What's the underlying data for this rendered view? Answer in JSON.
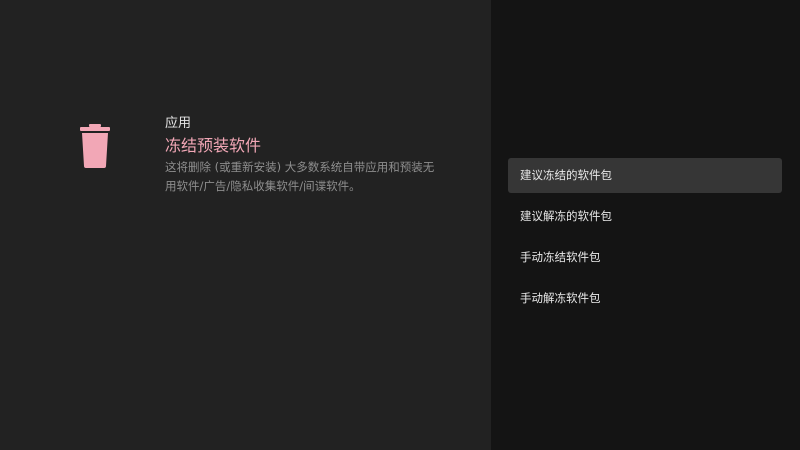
{
  "colors": {
    "accent": "#f2a7b6",
    "left_background": "#222222",
    "right_background": "#141414",
    "selected_item": "#363636"
  },
  "icon": "trash-icon",
  "info": {
    "category": "应用",
    "title": "冻结预装软件",
    "description": "这将删除 (或重新安装) 大多数系统自带应用和预装无用软件/广告/隐私收集软件/间谍软件。"
  },
  "menu": {
    "selected_index": 0,
    "items": [
      {
        "label": "建议冻结的软件包"
      },
      {
        "label": "建议解冻的软件包"
      },
      {
        "label": "手动冻结软件包"
      },
      {
        "label": "手动解冻软件包"
      }
    ]
  }
}
